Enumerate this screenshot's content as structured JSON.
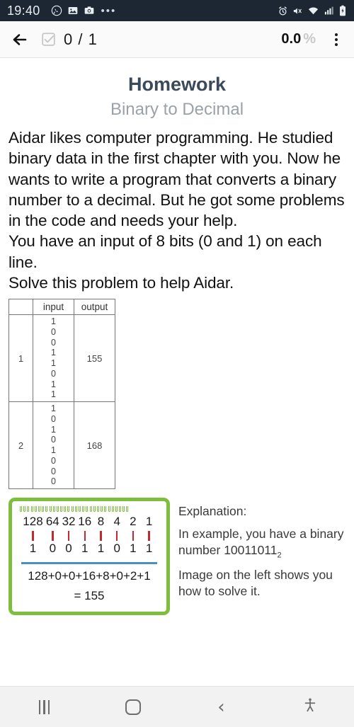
{
  "statusbar": {
    "time": "19:40",
    "left_icons": [
      "whatsapp-icon",
      "image-icon",
      "camera-icon"
    ],
    "overflow": "•••",
    "right_icons": [
      "alarm-icon",
      "mute-icon",
      "wifi-icon",
      "signal-icon",
      "battery-icon"
    ]
  },
  "toolbar": {
    "back_label": "←",
    "progress_count": "0 / 1",
    "percent_value": "0.0",
    "percent_sign": "%",
    "menu_label": "more-options"
  },
  "page": {
    "title": "Homework",
    "subtitle": "Binary to Decimal",
    "paragraphs": [
      "Aidar likes computer programming. He studied binary data in the first chapter with you. Now he wants to write a program that converts a binary number to a decimal. But he got some problems in the code and needs your help.",
      "You have an input of 8 bits (0 and 1) on each line.",
      "Solve this problem to help Aidar."
    ]
  },
  "table": {
    "headers": [
      "",
      "input",
      "output"
    ],
    "rows": [
      {
        "index": "1",
        "input_bits": [
          "1",
          "0",
          "0",
          "1",
          "1",
          "0",
          "1",
          "1"
        ],
        "output": "155"
      },
      {
        "index": "2",
        "input_bits": [
          "1",
          "0",
          "1",
          "0",
          "1",
          "0",
          "0",
          "0"
        ],
        "output": "168"
      }
    ]
  },
  "notecard": {
    "place_values": [
      "128",
      "64",
      "32",
      "16",
      "8",
      "4",
      "2",
      "1"
    ],
    "bits": [
      "1",
      "0",
      "0",
      "1",
      "1",
      "0",
      "1",
      "1"
    ],
    "sum_expression": "128+0+0+16+8+0+2+1",
    "result": "= 155",
    "border_color": "#7dbe3d",
    "dash_color": "#c22a32",
    "line_color": "#4a8fc2"
  },
  "explanation": {
    "heading": "Explanation:",
    "line1": "In example, you have a",
    "line2_prefix": "binary number 10011011",
    "line2_subscript": "2",
    "line3": "Image on the left shows you how to solve it."
  },
  "navbar": {
    "recents_label": "recents",
    "home_label": "home",
    "back_label": "‹",
    "accessibility_label": "accessibility"
  }
}
